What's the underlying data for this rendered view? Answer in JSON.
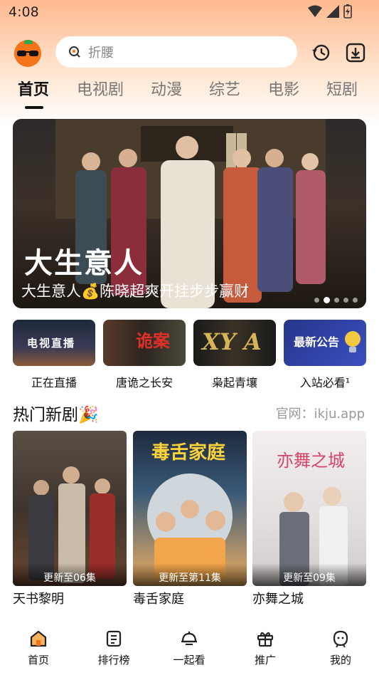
{
  "status_bar": {
    "time": "4:08"
  },
  "search": {
    "placeholder": "折腰"
  },
  "tabs": [
    {
      "label": "首页"
    },
    {
      "label": "电视剧"
    },
    {
      "label": "动漫"
    },
    {
      "label": "综艺"
    },
    {
      "label": "电影"
    },
    {
      "label": "短剧"
    }
  ],
  "banner": {
    "logo_text": "大生意人",
    "caption": "大生意人💰陈晓超爽开挂步步赢财",
    "page_count": 5,
    "current_page": 2
  },
  "quick_links": [
    {
      "label": "正在直播",
      "thumb_text": "电视直播"
    },
    {
      "label": "唐诡之长安",
      "thumb_text": "诡案"
    },
    {
      "label": "枭起青壤",
      "thumb_text": "XY A"
    },
    {
      "label": "入站必看¹",
      "thumb_text": "最新公告"
    }
  ],
  "section": {
    "title": "热门新剧🎉",
    "site": "官网：ikju.app"
  },
  "cards": [
    {
      "title": "天书黎明",
      "badge": "更新至06集"
    },
    {
      "title": "毒舌家庭",
      "badge": "更新至第11集",
      "poster_text": "毒舌家庭"
    },
    {
      "title": "亦舞之城",
      "badge": "更新至09集",
      "poster_text": "亦舞之城"
    }
  ],
  "bottom_nav": [
    {
      "label": "首页",
      "icon": "home-icon"
    },
    {
      "label": "排行榜",
      "icon": "ranking-icon"
    },
    {
      "label": "一起看",
      "icon": "watch-together-icon"
    },
    {
      "label": "推广",
      "icon": "gift-icon"
    },
    {
      "label": "我的",
      "icon": "profile-icon"
    }
  ],
  "colors": {
    "accent": "#f4741a",
    "header_gradient_top": "#ffb98f"
  }
}
